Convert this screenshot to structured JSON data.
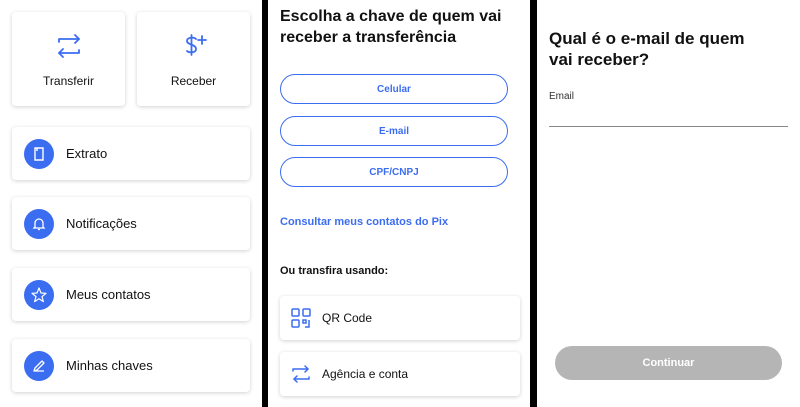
{
  "screen1": {
    "tiles": [
      {
        "label": "Transferir",
        "icon": "transfer-icon"
      },
      {
        "label": "Receber",
        "icon": "dollar-plus-icon"
      }
    ],
    "items": [
      {
        "label": "Extrato",
        "icon": "document-icon"
      },
      {
        "label": "Notificações",
        "icon": "bell-icon"
      },
      {
        "label": "Meus contatos",
        "icon": "star-icon"
      },
      {
        "label": "Minhas chaves",
        "icon": "pencil-icon"
      }
    ]
  },
  "screen2": {
    "title_line1": "Escolha a chave de quem vai",
    "title_line2": "receber a transferência",
    "options": [
      "Celular",
      "E-mail",
      "CPF/CNPJ"
    ],
    "contacts_link": "Consultar meus contatos do Pix",
    "alt_label": "Ou transfira usando:",
    "alt_options": [
      {
        "label": "QR Code",
        "icon": "qr-code-icon"
      },
      {
        "label": "Agência e conta",
        "icon": "transfer-icon"
      }
    ]
  },
  "screen3": {
    "title_line1": "Qual é o e-mail de quem",
    "title_line2": "vai receber?",
    "field_label": "Email",
    "field_value": "",
    "continue_label": "Continuar"
  },
  "colors": {
    "accent": "#3b6df0",
    "disabled_button": "#b5b5b5",
    "divider": "#000000"
  }
}
